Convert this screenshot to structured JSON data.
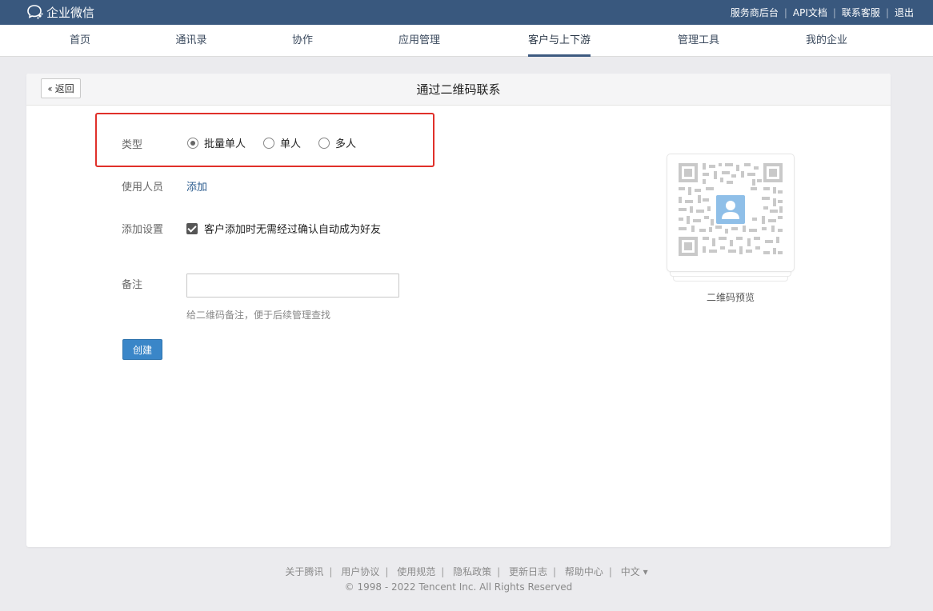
{
  "topbar": {
    "brand": "企业微信",
    "links": [
      "服务商后台",
      "API文档",
      "联系客服",
      "退出"
    ]
  },
  "nav": {
    "items": [
      "首页",
      "通讯录",
      "协作",
      "应用管理",
      "客户与上下游",
      "管理工具",
      "我的企业"
    ],
    "active": "客户与上下游"
  },
  "page": {
    "back_label": "返回",
    "title": "通过二维码联系"
  },
  "form": {
    "type_label": "类型",
    "type_options": [
      "批量单人",
      "单人",
      "多人"
    ],
    "type_selected": "批量单人",
    "users_label": "使用人员",
    "users_add": "添加",
    "settings_label": "添加设置",
    "auto_accept_label": "客户添加时无需经过确认自动成为好友",
    "auto_accept_checked": true,
    "remark_label": "备注",
    "remark_value": "",
    "remark_hint": "给二维码备注，便于后续管理查找",
    "create_label": "创建"
  },
  "preview": {
    "caption": "二维码预览"
  },
  "footer": {
    "links": [
      "关于腾讯",
      "用户协议",
      "使用规范",
      "隐私政策",
      "更新日志",
      "帮助中心",
      "中文 ▾"
    ],
    "copyright": "© 1998 - 2022 Tencent Inc. All Rights Reserved"
  },
  "colors": {
    "topbar": "#39587e",
    "highlight": "#e0302a",
    "primary_button": "#3a86c8",
    "link": "#2c5c8f"
  }
}
